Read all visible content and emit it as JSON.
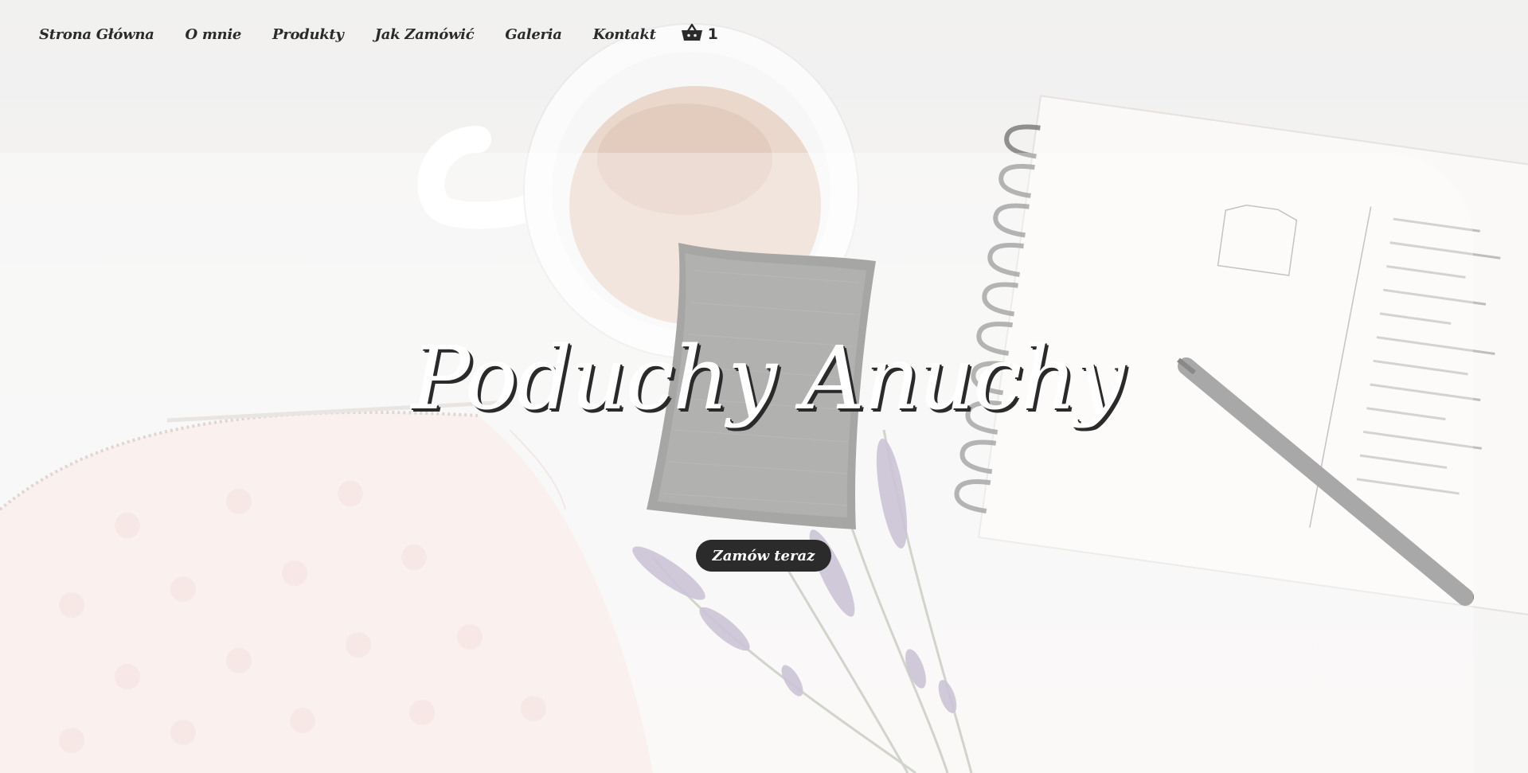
{
  "nav": {
    "items": [
      {
        "label": "Strona Główna"
      },
      {
        "label": "O mnie"
      },
      {
        "label": "Produkty"
      },
      {
        "label": "Jak Zamówić"
      },
      {
        "label": "Galeria"
      },
      {
        "label": "Kontakt"
      }
    ],
    "cart": {
      "icon": "basket-icon",
      "count": "1"
    }
  },
  "hero": {
    "title": "Poduchy Anuchy",
    "cta_label": "Zamów teraz"
  },
  "colors": {
    "text_dark": "#2b2b2b",
    "button_bg": "#2b2b2b",
    "title_fill": "#ffffff"
  }
}
